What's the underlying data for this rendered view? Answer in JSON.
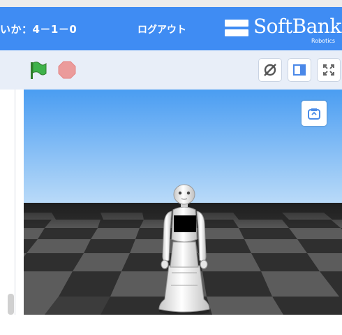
{
  "header": {
    "title": "いか：4－1－0",
    "logout_label": "ログアウト",
    "logo_text": "SoftBank",
    "logo_subtext": "Robotics",
    "background_color": "#3f8cf3"
  },
  "toolbar": {
    "flag_icon": "green-flag-icon",
    "stop_icon": "stop-icon",
    "buttons": [
      {
        "name": "hide-stage-button",
        "icon": "eye-slash-icon"
      },
      {
        "name": "small-stage-button",
        "icon": "sidebar-layout-icon"
      },
      {
        "name": "fullscreen-button",
        "icon": "expand-icon"
      }
    ]
  },
  "stage": {
    "camera_button_icon": "camera-reset-icon",
    "sky_top_color": "#4a9df2",
    "sky_bottom_color": "#b9daf8",
    "floor_dark_color": "#2f2f2f",
    "floor_light_color": "#5c5c5c"
  }
}
